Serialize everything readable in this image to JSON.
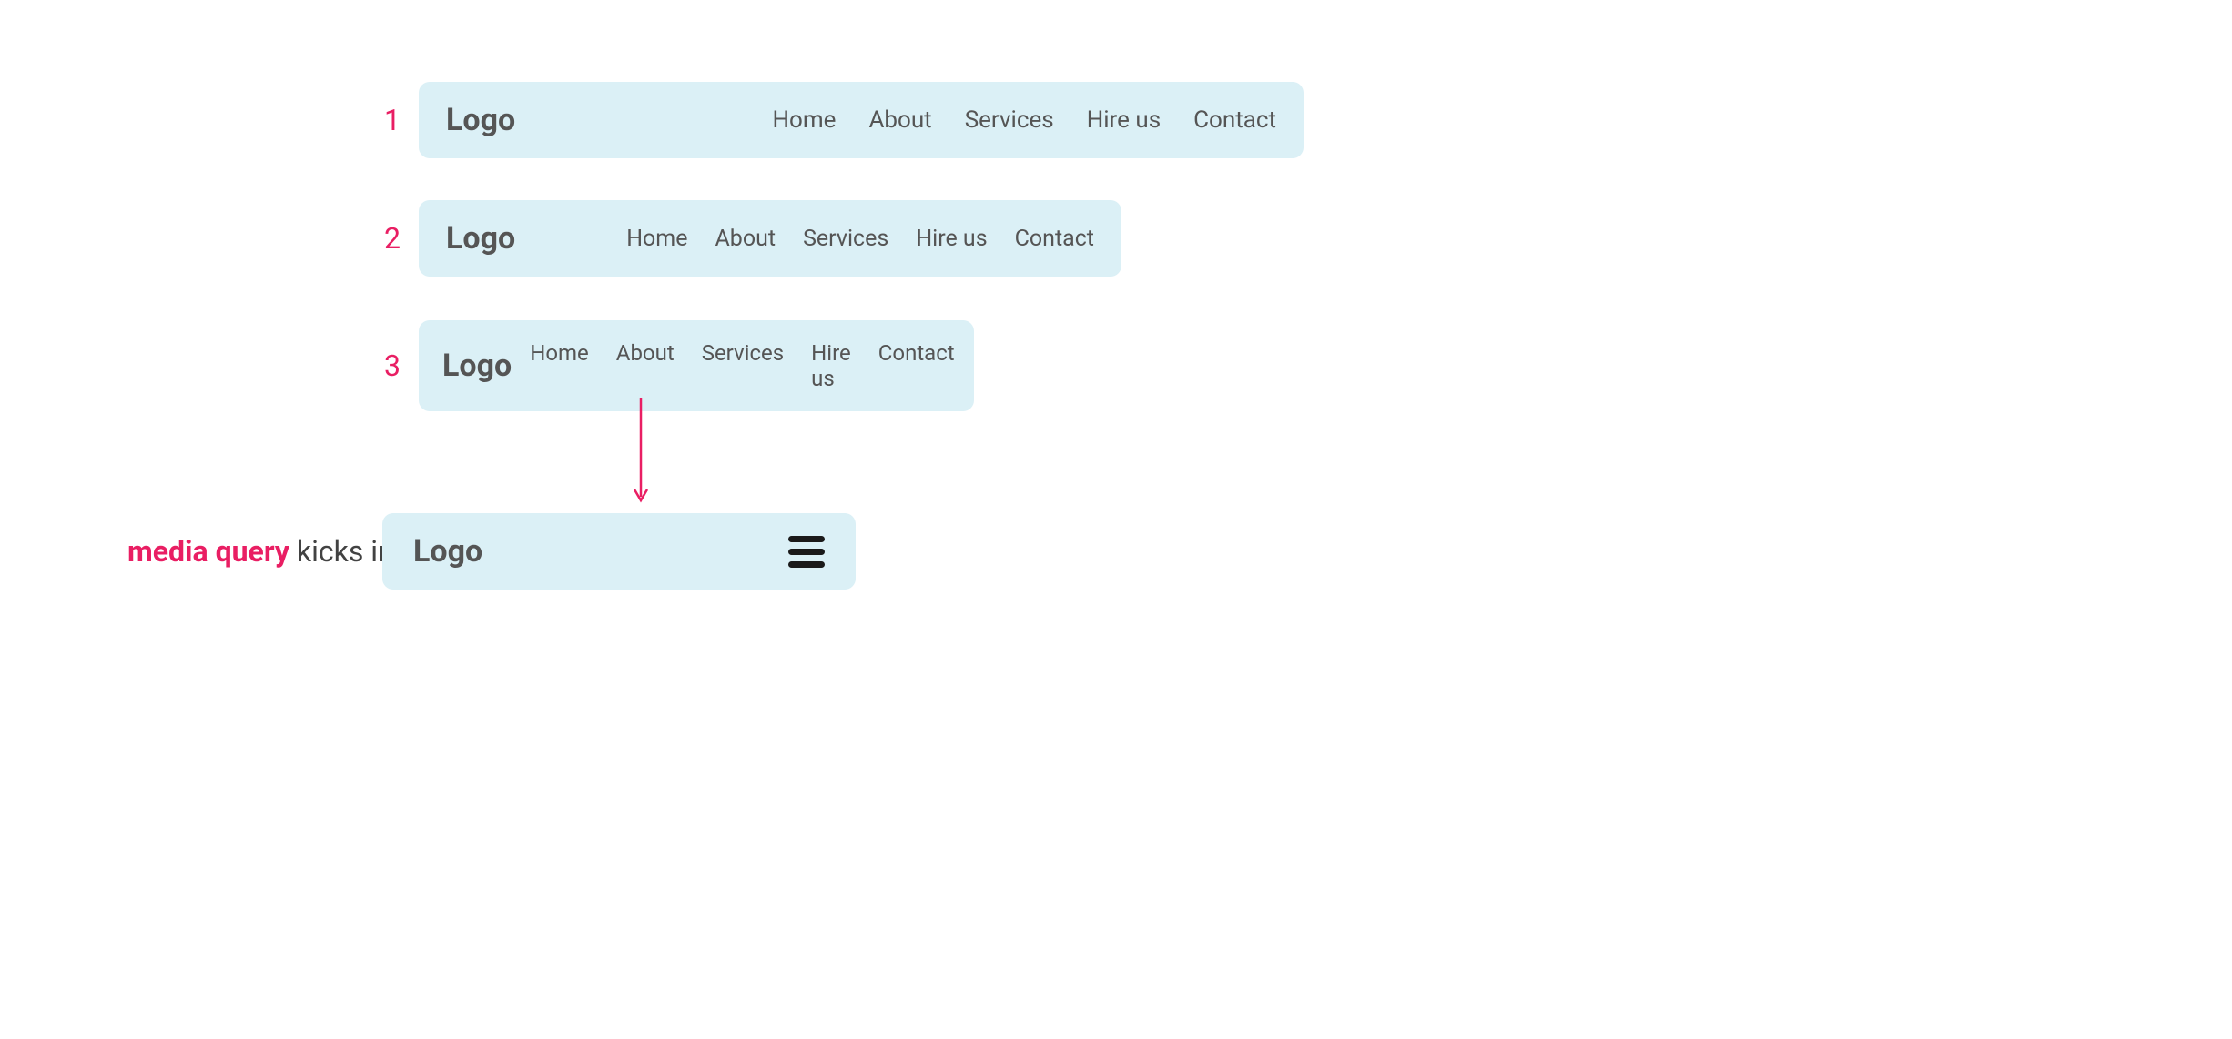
{
  "labels": {
    "num1": "1",
    "num2": "2",
    "num3": "3",
    "media_query": "media query",
    "kicks_in": " kicks in"
  },
  "nav": {
    "logo": "Logo",
    "items": [
      "Home",
      "About",
      "Services",
      "Hire us",
      "Contact"
    ]
  },
  "colors": {
    "accent": "#e91e63",
    "navbg": "#dbf0f6",
    "text": "#555"
  }
}
